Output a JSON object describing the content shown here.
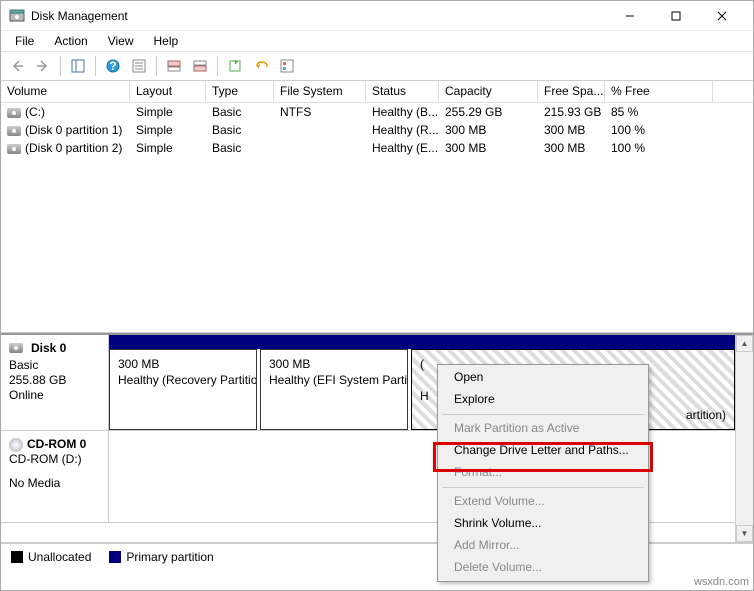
{
  "window": {
    "title": "Disk Management"
  },
  "menu": {
    "file": "File",
    "action": "Action",
    "view": "View",
    "help": "Help"
  },
  "columns": {
    "volume": "Volume",
    "layout": "Layout",
    "type": "Type",
    "fs": "File System",
    "status": "Status",
    "capacity": "Capacity",
    "free": "Free Spa...",
    "pct": "% Free"
  },
  "volumes": [
    {
      "name": "(C:)",
      "layout": "Simple",
      "type": "Basic",
      "fs": "NTFS",
      "status": "Healthy (B...",
      "capacity": "255.29 GB",
      "free": "215.93 GB",
      "pct": "85 %"
    },
    {
      "name": "(Disk 0 partition 1)",
      "layout": "Simple",
      "type": "Basic",
      "fs": "",
      "status": "Healthy (R...",
      "capacity": "300 MB",
      "free": "300 MB",
      "pct": "100 %"
    },
    {
      "name": "(Disk 0 partition 2)",
      "layout": "Simple",
      "type": "Basic",
      "fs": "",
      "status": "Healthy (E...",
      "capacity": "300 MB",
      "free": "300 MB",
      "pct": "100 %"
    }
  ],
  "disk0": {
    "name": "Disk 0",
    "type": "Basic",
    "size": "255.88 GB",
    "state": "Online",
    "p1_size": "300 MB",
    "p1_status": "Healthy (Recovery Partitio",
    "p2_size": "300 MB",
    "p2_status": "Healthy (EFI System Partit",
    "p3_label": "(",
    "p3_status": "H",
    "p3_tail": "artition)"
  },
  "cdrom": {
    "name": "CD-ROM 0",
    "drive": "CD-ROM (D:)",
    "state": "No Media"
  },
  "legend": {
    "unalloc": "Unallocated",
    "primary": "Primary partition"
  },
  "ctx": {
    "open": "Open",
    "explore": "Explore",
    "mark": "Mark Partition as Active",
    "change": "Change Drive Letter and Paths...",
    "format": "Format...",
    "extend": "Extend Volume...",
    "shrink": "Shrink Volume...",
    "mirror": "Add Mirror...",
    "delete": "Delete Volume..."
  },
  "watermark": "wsxdn.com"
}
